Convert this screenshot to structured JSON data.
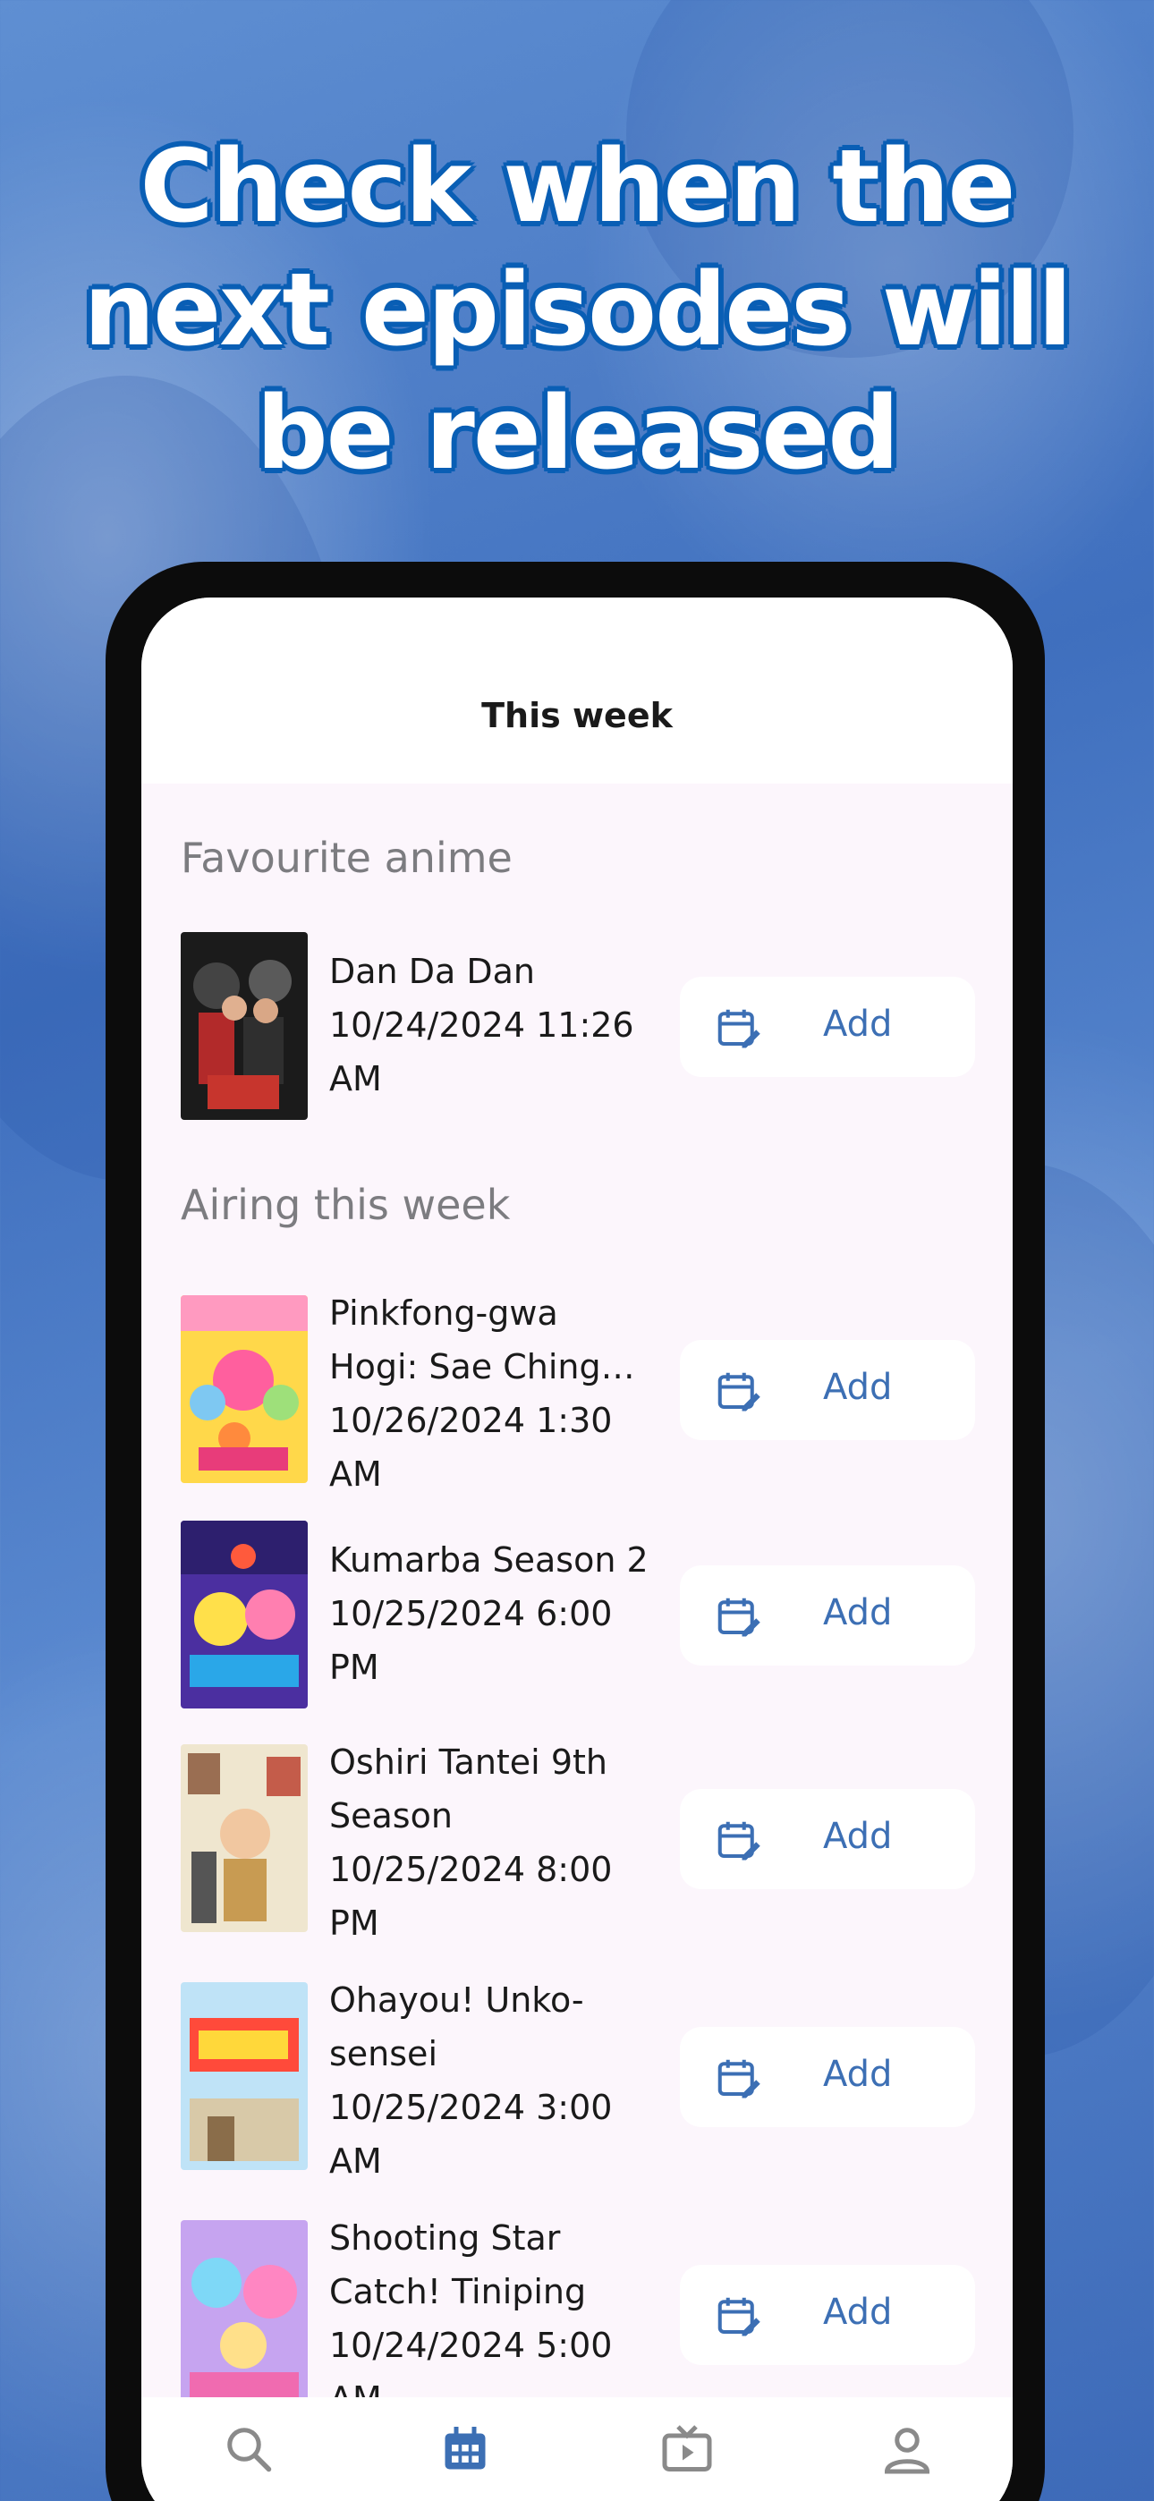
{
  "headline": {
    "line1": "Check when the",
    "line2": "next episodes will",
    "line3": "be released"
  },
  "app": {
    "title": "This week",
    "sections": {
      "favourite": "Favourite anime",
      "airing": "Airing this week"
    },
    "add_label": "Add",
    "favourites": [
      {
        "name": "Dan Da Dan",
        "date_line1": "10/24/2024 11:26",
        "date_line2": "AM"
      }
    ],
    "airing": [
      {
        "name_line1": "Pinkfong-gwa",
        "name_line2": "Hogi: Sae Chingu...",
        "date_line1": "10/26/2024 1:30",
        "date_line2": "AM"
      },
      {
        "name_line1": "Kumarba Season 2",
        "name_line2": "",
        "date_line1": "10/25/2024 6:00",
        "date_line2": "PM"
      },
      {
        "name_line1": "Oshiri Tantei 9th",
        "name_line2": "Season",
        "date_line1": "10/25/2024 8:00",
        "date_line2": "PM"
      },
      {
        "name_line1": "Ohayou! Unko-",
        "name_line2": "sensei",
        "date_line1": "10/25/2024 3:00",
        "date_line2": "AM"
      },
      {
        "name_line1": "Shooting Star",
        "name_line2": "Catch! Tiniping",
        "date_line1": "10/24/2024 5:00",
        "date_line2": "AM"
      }
    ],
    "tabs": [
      "search-icon",
      "calendar-icon",
      "tv-icon",
      "profile-icon"
    ],
    "colors": {
      "accent": "#3c6fb4",
      "headline_outline": "#0a5fb5",
      "content_bg": "#fcf6fc"
    }
  }
}
